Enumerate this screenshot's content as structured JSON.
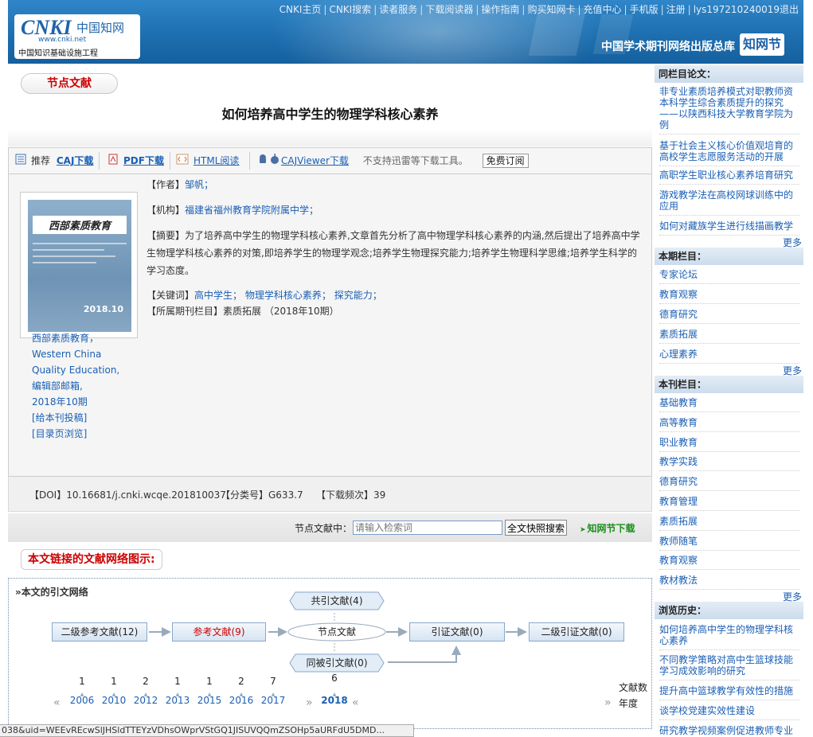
{
  "header": {
    "logo_brand": "CNKI",
    "logo_cn": "中国知网",
    "logo_url": "www.cnki.net",
    "logo_subtitle": "中国知识基础设施工程",
    "right_title": "中国学术期刊网络出版总库",
    "badge": "知网节",
    "nav": [
      "CNKI主页",
      "CNKI搜索",
      "读者服务",
      "下载阅读器",
      "操作指南",
      "购买知网卡",
      "充值中心",
      "手机版",
      "注册",
      "lys197210240019退出"
    ]
  },
  "main": {
    "node_tag": "节点文献",
    "title": "如何培养高中学生的物理学科核心素养",
    "toolbar": {
      "recommend": "推荐",
      "caj": "CAJ下载",
      "pdf": "PDF下载",
      "html": "HTML阅读",
      "cajviewer": "CAJViewer下载",
      "note": "不支持迅雷等下载工具。",
      "subscribe": "免费订阅"
    },
    "cover": {
      "title": "西部素质教育",
      "year": "2018.10"
    },
    "journal_info": [
      "西部素质教育，",
      "Western China",
      "Quality Education,",
      "编辑部邮箱,",
      "2018年10期",
      "[给本刊投稿]",
      "[目录页浏览]"
    ],
    "meta": {
      "author_label": "【作者】",
      "author": "邹帆；",
      "org_label": "【机构】",
      "org": "福建省福州教育学院附属中学；",
      "abstract_label": "【摘要】",
      "abstract": "为了培养高中学生的物理学科核心素养,文章首先分析了高中物理学科核心素养的内涵,然后提出了培养高中学生物理学科核心素养的对策,即培养学生的物理学观念;培养学生物理探究能力;培养学生物理科学思维;培养学生科学的学习态度。",
      "keywords_label": "【关键词】",
      "keywords": [
        "高中学生；",
        "物理学科核心素养；",
        "探究能力；"
      ],
      "column_label": "【所属期刊栏目】",
      "column": "素质拓展 （2018年10期）"
    },
    "doi_bar": {
      "doi": "【DOI】10.16681/j.cnki.wcqe.201810037",
      "class": "【分类号】G633.7",
      "downloads": "【下载频次】39"
    },
    "search": {
      "label": "节点文献中：",
      "placeholder": "请输入检索词",
      "button": "全文快照搜索",
      "node_download": "知网节下载"
    },
    "network": {
      "title": "本文链接的文献网络图示:",
      "label": "»本文的引文网络",
      "second_refs": "二级参考文献(12)",
      "refs": "参考文献(9)",
      "node": "节点文献",
      "citing": "引证文献(0)",
      "second_citing": "二级引证文献(0)",
      "co_cited": "共引文献(4)",
      "co_citing": "同被引文献(0)",
      "years": [
        {
          "count": "1",
          "year": "2006"
        },
        {
          "count": "1",
          "year": "2010"
        },
        {
          "count": "2",
          "year": "2012"
        },
        {
          "count": "1",
          "year": "2013"
        },
        {
          "count": "1",
          "year": "2015"
        },
        {
          "count": "2",
          "year": "2016"
        },
        {
          "count": "7",
          "year": "2017"
        }
      ],
      "selected_year": {
        "count": "6",
        "year": "2018"
      },
      "count_label": "文献数",
      "year_label": "年度"
    }
  },
  "status_bar": "038&uid=WEEvREcwSlJHSldTTEYzVDhsOWprVStGQ1JISUVQQmZSOHp5aURFdU5DMD...",
  "sidebar": {
    "same_column_title": "同栏目论文：",
    "same_column": [
      "非专业素质培养模式对职教师资本科学生综合素质提升的探究——以陕西科技大学教育学院为例",
      "基于社会主义核心价值观培育的高校学生志愿服务活动的开展",
      "高职学生职业核心素养培育研究",
      "游戏教学法在高校网球训练中的应用",
      "如何对藏族学生进行线描画教学"
    ],
    "more": "更多",
    "issue_title": "本期栏目：",
    "issue_items": [
      "专家论坛",
      "教育观察",
      "德育研究",
      "素质拓展",
      "心理素养"
    ],
    "journal_title": "本刊栏目：",
    "journal_items": [
      "基础教育",
      "高等教育",
      "职业教育",
      "教学实践",
      "德育研究",
      "教育管理",
      "素质拓展",
      "教师随笔",
      "教育观察",
      "教材教法"
    ],
    "history_title": "浏览历史：",
    "history_items": [
      "如何培养高中学生的物理学科核心素养",
      "不同教学策略对高中生篮球技能学习成效影响的研究",
      "提升高中篮球教学有效性的措施",
      "谈学校党建实效性建设",
      "研究教学视频案例促进教师专业"
    ]
  }
}
